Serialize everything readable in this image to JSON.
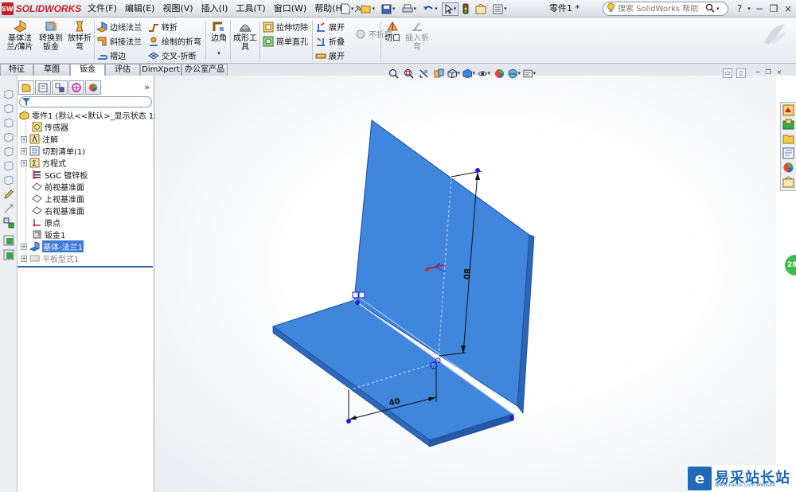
{
  "app": {
    "logo_badge": "SW",
    "logo_text": "SOLIDWORKS",
    "document_title": "零件1 *"
  },
  "menu": [
    "文件(F)",
    "编辑(E)",
    "视图(V)",
    "插入(I)",
    "工具(T)",
    "窗口(W)",
    "帮助(H)"
  ],
  "search": {
    "placeholder": "搜索 SolidWorks 帮助"
  },
  "window_controls": {
    "help": "?",
    "minimize": "−",
    "restore": "❐",
    "close": "×"
  },
  "command_manager": {
    "base_flange": "基体法\n兰/薄片",
    "convert_to_sheet": "转换到\n钣金",
    "lofted_bend": "放样折\n弯",
    "edge_flange": "边线法兰",
    "miter_flange": "斜接法兰",
    "hem": "褶边",
    "jog": "转折",
    "sketched_bend": "绘制的折弯",
    "cross_break": "交叉-折断",
    "corners": "边角",
    "forming_tool": "成形工\n具",
    "extruded_cut": "拉伸切除",
    "simple_hole": "简单直孔",
    "unfold": "展开",
    "fold": "折叠",
    "flatten": "展开",
    "no_bends": "不折弯",
    "rip": "切口",
    "insert_bends": "插入折\n弯"
  },
  "tabs": [
    "特征",
    "草图",
    "钣金",
    "评估",
    "DimXpert",
    "办公室产品"
  ],
  "active_tab": "钣金",
  "feature_tree": {
    "root": "零件1 (默认<<默认>_显示状态 1>)",
    "items": [
      {
        "label": "传感器",
        "expandable": false
      },
      {
        "label": "注解",
        "expandable": true
      },
      {
        "label": "切割清单(1)",
        "expandable": true
      },
      {
        "label": "方程式",
        "expandable": true
      },
      {
        "label": "SGC 镀锌板",
        "expandable": false
      },
      {
        "label": "前视基准面",
        "expandable": false
      },
      {
        "label": "上视基准面",
        "expandable": false
      },
      {
        "label": "右视基准面",
        "expandable": false
      },
      {
        "label": "原点",
        "expandable": false
      },
      {
        "label": "钣金1",
        "expandable": false
      },
      {
        "label": "基体-法兰1",
        "expandable": true,
        "selected": true
      },
      {
        "label": "平板型式1",
        "expandable": true,
        "suppressed": true
      }
    ]
  },
  "model": {
    "dim_horizontal": "40",
    "dim_vertical": "80",
    "part_color": "#3f86dc",
    "part_edge_color": "#1d4f96"
  },
  "task_pane_badge": "28",
  "watermark": {
    "text": "易采站长站",
    "sub": "Www.Easck.Com  Website"
  }
}
